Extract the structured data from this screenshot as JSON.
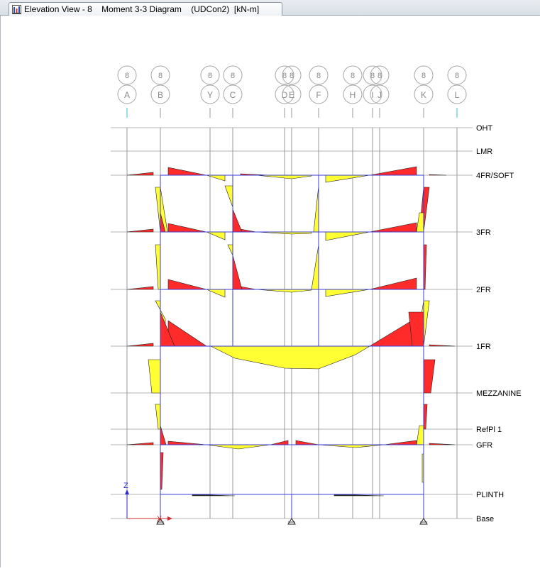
{
  "window": {
    "tab_title": "Elevation View - 8    Moment 3-3 Diagram    (UDCon2)  [kN-m]",
    "tab_icon": "elevation-view-icon"
  },
  "view": {
    "bubble_row_label": "8",
    "axis_z_label": "Z",
    "axis_x_label": "X"
  },
  "gridlines": [
    {
      "label": "A"
    },
    {
      "label": "B"
    },
    {
      "label": "Y"
    },
    {
      "label": "C"
    },
    {
      "label": "D"
    },
    {
      "label": "E"
    },
    {
      "label": "F"
    },
    {
      "label": "H"
    },
    {
      "label": "I"
    },
    {
      "label": "J"
    },
    {
      "label": "K"
    },
    {
      "label": "L"
    }
  ],
  "stories": [
    {
      "label": "OHT"
    },
    {
      "label": "LMR"
    },
    {
      "label": "4FR/SOFT"
    },
    {
      "label": "3FR"
    },
    {
      "label": "2FR"
    },
    {
      "label": "1FR"
    },
    {
      "label": "MEZZANINE"
    },
    {
      "label": "RefPl 1"
    },
    {
      "label": "GFR"
    },
    {
      "label": "PLINTH"
    },
    {
      "label": "Base"
    }
  ],
  "colors": {
    "positive_moment": "#ffff33",
    "negative_moment": "#ff2a2a",
    "frame": "#3b3bd6",
    "grid": "#9a9a9a",
    "story_line": "#b5b5b5",
    "bubble": "#a6a6a6"
  }
}
